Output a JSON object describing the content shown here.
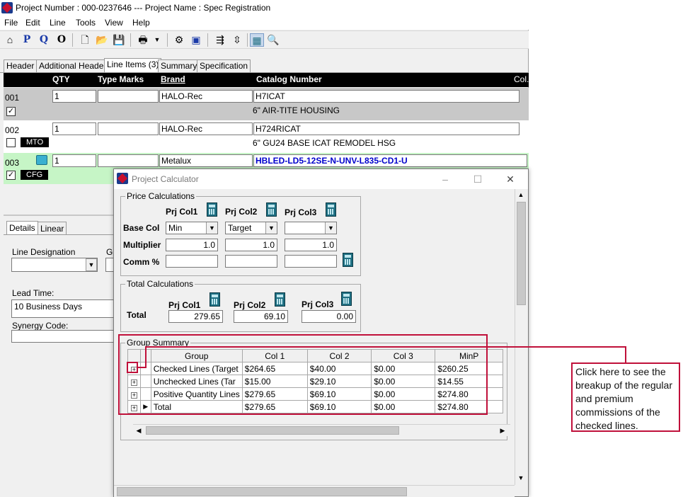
{
  "window": {
    "title": "Project Number : 000-0237646 --- Project Name : Spec Registration"
  },
  "menu": [
    "File",
    "Edit",
    "Line",
    "Tools",
    "View",
    "Help"
  ],
  "toolbar": {
    "p_label": "P",
    "q_label": "Q",
    "o_label": "O"
  },
  "tabs": [
    "Header",
    "Additional Header",
    "Line Items (3)",
    "Summary",
    "Specification"
  ],
  "grid": {
    "headers": {
      "qty": "QTY",
      "type_marks": "Type Marks",
      "brand": "Brand",
      "catalog": "Catalog Number",
      "col": "Col."
    },
    "rows": [
      {
        "num": "001",
        "qty": "1",
        "type_marks": "",
        "brand": "HALO-Rec",
        "catalog": "H7ICAT",
        "description": "6\" AIR-TITE HOUSING",
        "checked": true,
        "badge": ""
      },
      {
        "num": "002",
        "qty": "1",
        "type_marks": "",
        "brand": "HALO-Rec",
        "catalog": "H724RICAT",
        "description": "6\" GU24 BASE ICAT REMODEL HSG",
        "checked": false,
        "badge": "MTO"
      },
      {
        "num": "003",
        "qty": "1",
        "type_marks": "",
        "brand": "Metalux",
        "catalog": "HBLED-LD5-12SE-N-UNV-L835-CD1-U",
        "description": "",
        "checked": true,
        "badge": "CFG"
      }
    ]
  },
  "details": {
    "tabs": [
      "Details",
      "Linear"
    ],
    "line_designation_label": "Line Designation",
    "line_designation_value": "",
    "cut_label": "G",
    "lead_time_label": "Lead Time:",
    "lead_time_value": "10 Business Days",
    "synergy_label": "Synergy Code:",
    "synergy_value": ""
  },
  "calculator": {
    "title": "Project Calculator",
    "price_section": "Price Calculations",
    "col_headers": [
      "Prj Col1",
      "Prj Col2",
      "Prj Col3"
    ],
    "base_col_label": "Base Col",
    "base_col_values": [
      "Min",
      "Target",
      ""
    ],
    "multiplier_label": "Multiplier",
    "multiplier_values": [
      "1.0",
      "1.0",
      "1.0"
    ],
    "comm_label": "Comm %",
    "comm_values": [
      "",
      "",
      ""
    ],
    "total_section": "Total Calculations",
    "total_label": "Total",
    "total_col_headers": [
      "Prj Col1",
      "Prj Col2",
      "Prj Col3"
    ],
    "total_values": [
      "279.65",
      "69.10",
      "0.00"
    ],
    "group_summary": {
      "title": "Group Summary",
      "columns": [
        "Group",
        "Col 1",
        "Col 2",
        "Col 3",
        "MinP"
      ],
      "rows": [
        {
          "group": "Checked Lines (Target",
          "col1": "$264.65",
          "col2": "$40.00",
          "col3": "$0.00",
          "minp": "$260.25"
        },
        {
          "group": "Unchecked Lines (Tar",
          "col1": "$15.00",
          "col2": "$29.10",
          "col3": "$0.00",
          "minp": "$14.55"
        },
        {
          "group": "Positive Quantity Lines",
          "col1": "$279.65",
          "col2": "$69.10",
          "col3": "$0.00",
          "minp": "$274.80"
        },
        {
          "group": "Total",
          "col1": "$279.65",
          "col2": "$69.10",
          "col3": "$0.00",
          "minp": "$274.80"
        }
      ]
    }
  },
  "callout": {
    "text": "Click here to see the breakup of the regular and premium commissions of the checked lines."
  },
  "colors": {
    "accent_red": "#c0103a",
    "selected_row": "#c8c8c8",
    "cfg_row": "#c6f5c6",
    "catalog_blue": "#0000cc"
  }
}
